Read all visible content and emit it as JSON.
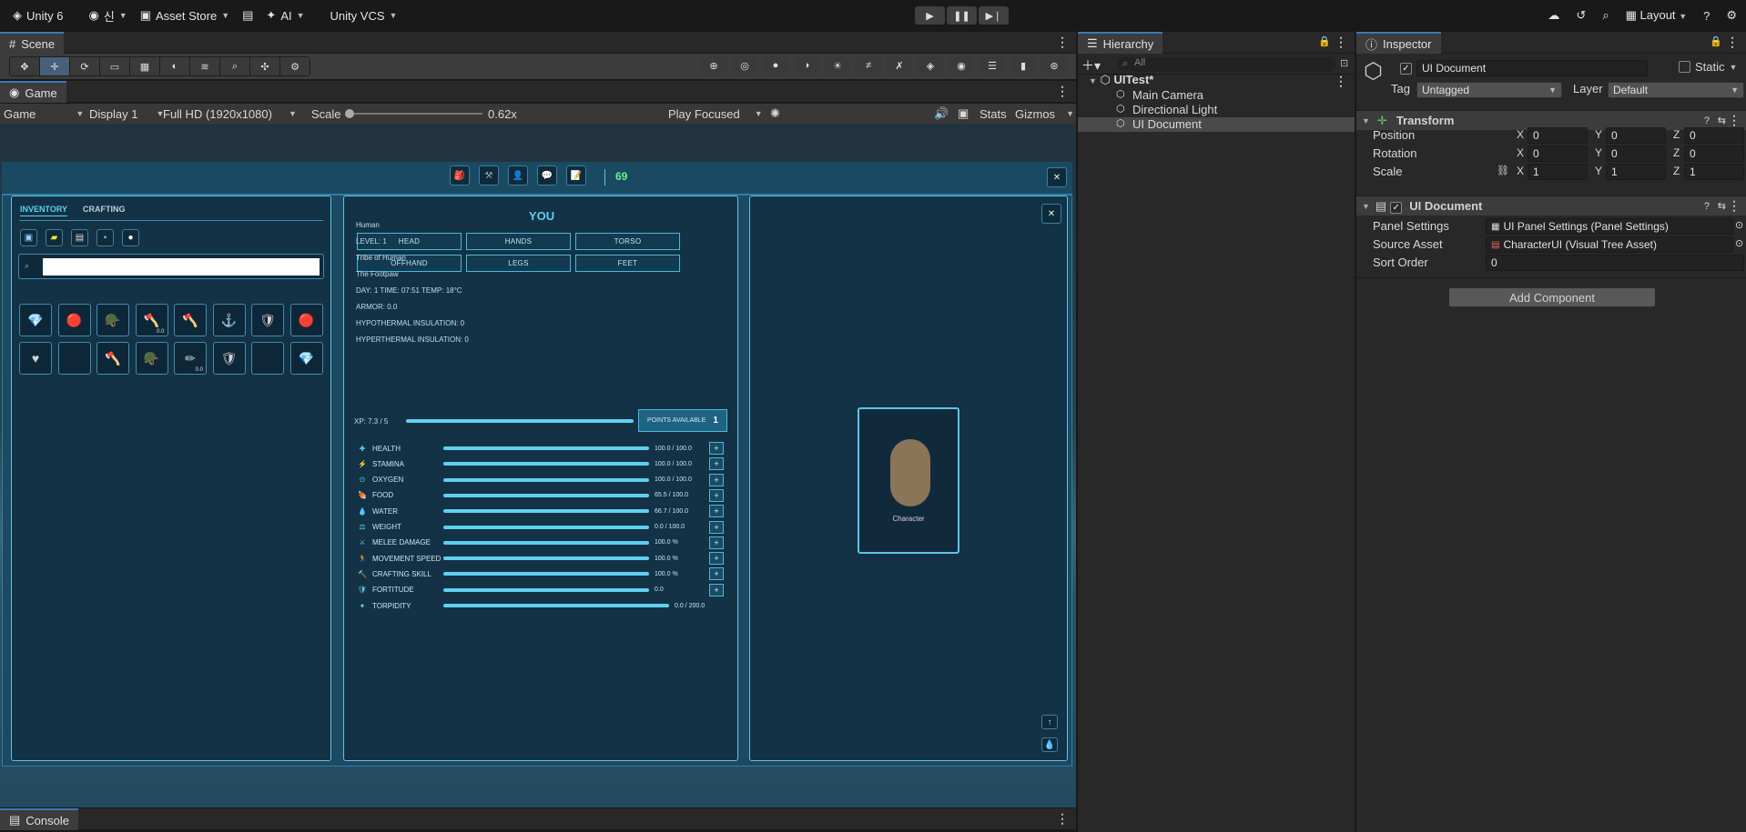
{
  "topbar": {
    "app": "Unity 6",
    "account": "신",
    "asset_store": "Asset Store",
    "ai": "AI",
    "vcs": "Unity VCS",
    "layout": "Layout"
  },
  "scene_tab": "Scene",
  "game_tab": "Game",
  "gamebar": {
    "mode": "Game",
    "display": "Display 1",
    "resolution": "Full HD (1920x1080)",
    "scale_label": "Scale",
    "scale_value": "0.62x",
    "play_mode": "Play Focused",
    "stats": "Stats",
    "gizmos": "Gizmos",
    "scale_fraction": 0.0
  },
  "game": {
    "counter": "69",
    "inventory": {
      "tab_inventory": "INVENTORY",
      "tab_crafting": "CRAFTING",
      "search_placeholder": "",
      "slots_row1": [
        "💎",
        "🔴",
        "🪖",
        "🪓",
        "🪓",
        "⚓",
        "🛡",
        "🔴"
      ],
      "slot_counts_row1": [
        "",
        "",
        "",
        "0.0",
        "",
        "",
        "",
        ""
      ],
      "slots_row2": [
        "♥",
        "",
        "🪓",
        "🪖",
        "✏",
        "🛡",
        "",
        "💎"
      ],
      "slot_counts_row2": [
        "",
        "",
        "",
        "",
        "0.0",
        "",
        "",
        ""
      ]
    },
    "character": {
      "title": "YOU",
      "equip": [
        "HEAD",
        "HANDS",
        "TORSO",
        "OFFHAND",
        "LEGS",
        "FEET"
      ],
      "info": [
        "Human",
        "LEVEL: 1",
        "Tribe of Human",
        "The Footpaw",
        "DAY: 1   TIME: 07:51   TEMP: 18°C",
        "ARMOR: 0.0",
        "HYPOTHERMAL INSULATION: 0",
        "HYPERTHERMAL INSULATION: 0"
      ],
      "xp_label": "XP: 7.3 / 5",
      "points_label": "POINTS AVAILABLE",
      "points_value": "1",
      "stats": [
        {
          "icon": "✚",
          "name": "HEALTH",
          "value": "100.0 / 100.0",
          "fill": 1.0,
          "plus": "+"
        },
        {
          "icon": "⚡",
          "name": "STAMINA",
          "value": "100.0 / 100.0",
          "fill": 1.0,
          "plus": "+"
        },
        {
          "icon": "⊙",
          "name": "OXYGEN",
          "value": "100.0 / 100.0",
          "fill": 1.0,
          "plus": "+"
        },
        {
          "icon": "🍖",
          "name": "FOOD",
          "value": "65.5 / 100.0",
          "fill": 1.0,
          "plus": "+"
        },
        {
          "icon": "💧",
          "name": "WATER",
          "value": "66.7 / 100.0",
          "fill": 1.0,
          "plus": "+"
        },
        {
          "icon": "⚖",
          "name": "WEIGHT",
          "value": "0.0 / 100.0",
          "fill": 1.0,
          "plus": "+"
        },
        {
          "icon": "⚔",
          "name": "MELEE DAMAGE",
          "value": "100.0 %",
          "fill": 1.0,
          "plus": "+"
        },
        {
          "icon": "🏃",
          "name": "MOVEMENT SPEED",
          "value": "100.0 %",
          "fill": 1.0,
          "plus": "+"
        },
        {
          "icon": "🔨",
          "name": "CRAFTING SKILL",
          "value": "100.0 %",
          "fill": 1.0,
          "plus": "+"
        },
        {
          "icon": "🛡",
          "name": "FORTITUDE",
          "value": "0.0",
          "fill": 1.0,
          "plus": "+"
        },
        {
          "icon": "✦",
          "name": "TORPIDITY",
          "value": "0.0 / 200.0",
          "fill": 1.0,
          "plus": ""
        }
      ]
    },
    "preview": {
      "label": "Character"
    }
  },
  "hierarchy": {
    "tab": "Hierarchy",
    "search_placeholder": "All",
    "root": "UITest*",
    "items": [
      "Main Camera",
      "Directional Light",
      "UI Document"
    ]
  },
  "inspector": {
    "tab": "Inspector",
    "object_name": "UI Document",
    "static_label": "Static",
    "tag_label": "Tag",
    "tag_value": "Untagged",
    "layer_label": "Layer",
    "layer_value": "Default",
    "transform": {
      "title": "Transform",
      "position_label": "Position",
      "rotation_label": "Rotation",
      "scale_label": "Scale",
      "x": "X",
      "y": "Y",
      "z": "Z",
      "position": [
        "0",
        "0",
        "0"
      ],
      "rotation": [
        "0",
        "0",
        "0"
      ],
      "scale": [
        "1",
        "1",
        "1"
      ]
    },
    "uidoc": {
      "title": "UI Document",
      "panel_label": "Panel Settings",
      "panel_value": "UI Panel Settings (Panel Settings)",
      "source_label": "Source Asset",
      "source_value": "CharacterUI (Visual Tree Asset)",
      "sort_label": "Sort Order",
      "sort_value": "0"
    },
    "add_component": "Add Component"
  },
  "console_tab": "Console"
}
